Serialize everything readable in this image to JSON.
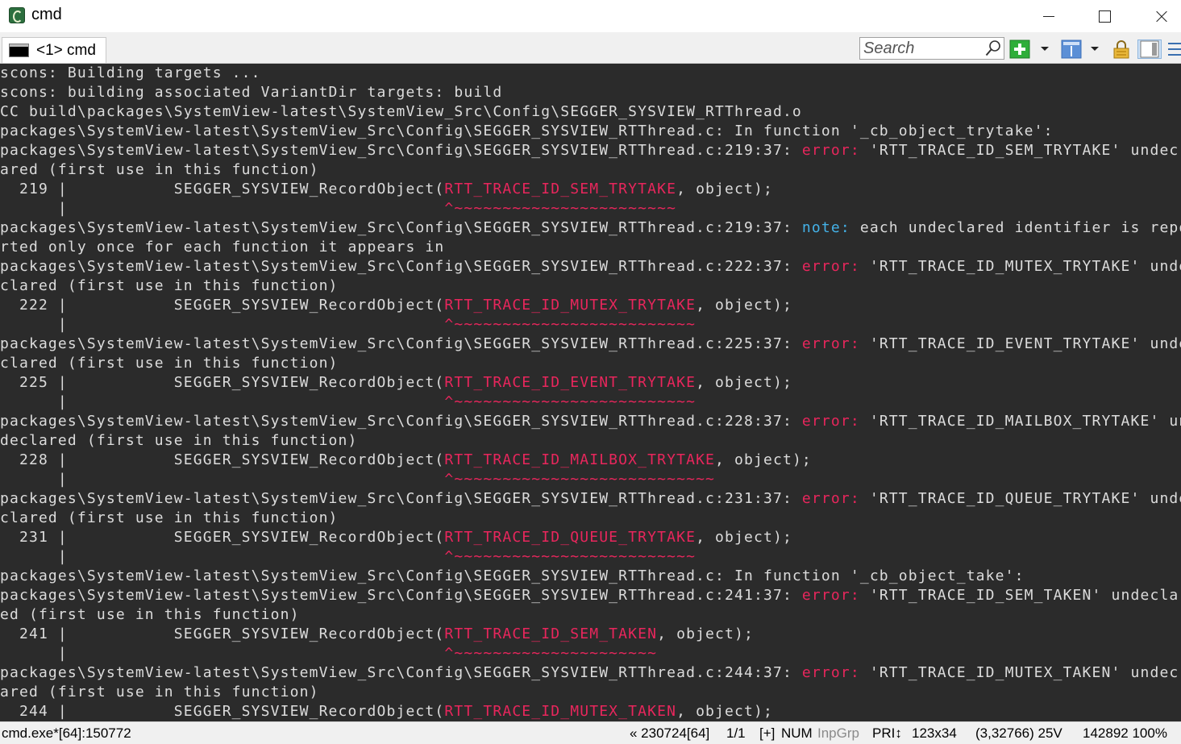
{
  "window": {
    "title": "cmd",
    "icon": "conemu-icon"
  },
  "tabs": [
    {
      "label": "<1> cmd",
      "icon": "console-icon",
      "active": true
    }
  ],
  "toolbar": {
    "search_placeholder": "Search"
  },
  "colors": {
    "console_bg": "#2b2b2b",
    "console_text": "#dcdcdc",
    "error": "#e8265c",
    "note": "#44b2e8"
  },
  "console": {
    "lines": [
      [
        {
          "t": "scons: Building targets ..."
        }
      ],
      [
        {
          "t": "scons: building associated VariantDir targets: build"
        }
      ],
      [
        {
          "t": "CC build\\packages\\SystemView-latest\\SystemView_Src\\Config\\SEGGER_SYSVIEW_RTThread.o"
        }
      ],
      [
        {
          "t": "packages\\SystemView-latest\\SystemView_Src\\Config\\SEGGER_SYSVIEW_RTThread.c: In function '_cb_object_trytake':"
        }
      ],
      [
        {
          "t": "packages\\SystemView-latest\\SystemView_Src\\Config\\SEGGER_SYSVIEW_RTThread.c:219:37: "
        },
        {
          "t": "error:",
          "c": "error"
        },
        {
          "t": " 'RTT_TRACE_ID_SEM_TRYTAKE' undec"
        }
      ],
      [
        {
          "t": "ared (first use in this function)"
        }
      ],
      [
        {
          "t": "  219 |           SEGGER_SYSVIEW_RecordObject("
        },
        {
          "t": "RTT_TRACE_ID_SEM_TRYTAKE",
          "c": "hl"
        },
        {
          "t": ", object);"
        }
      ],
      [
        {
          "t": "      |                                       "
        },
        {
          "t": "^~~~~~~~~~~~~~~~~~~~~~~~",
          "c": "caret"
        }
      ],
      [
        {
          "t": "packages\\SystemView-latest\\SystemView_Src\\Config\\SEGGER_SYSVIEW_RTThread.c:219:37: "
        },
        {
          "t": "note:",
          "c": "note"
        },
        {
          "t": " each undeclared identifier is repo"
        }
      ],
      [
        {
          "t": "rted only once for each function it appears in"
        }
      ],
      [
        {
          "t": "packages\\SystemView-latest\\SystemView_Src\\Config\\SEGGER_SYSVIEW_RTThread.c:222:37: "
        },
        {
          "t": "error:",
          "c": "error"
        },
        {
          "t": " 'RTT_TRACE_ID_MUTEX_TRYTAKE' unde"
        }
      ],
      [
        {
          "t": "clared (first use in this function)"
        }
      ],
      [
        {
          "t": "  222 |           SEGGER_SYSVIEW_RecordObject("
        },
        {
          "t": "RTT_TRACE_ID_MUTEX_TRYTAKE",
          "c": "hl"
        },
        {
          "t": ", object);"
        }
      ],
      [
        {
          "t": "      |                                       "
        },
        {
          "t": "^~~~~~~~~~~~~~~~~~~~~~~~~~",
          "c": "caret"
        }
      ],
      [
        {
          "t": "packages\\SystemView-latest\\SystemView_Src\\Config\\SEGGER_SYSVIEW_RTThread.c:225:37: "
        },
        {
          "t": "error:",
          "c": "error"
        },
        {
          "t": " 'RTT_TRACE_ID_EVENT_TRYTAKE' unde"
        }
      ],
      [
        {
          "t": "clared (first use in this function)"
        }
      ],
      [
        {
          "t": "  225 |           SEGGER_SYSVIEW_RecordObject("
        },
        {
          "t": "RTT_TRACE_ID_EVENT_TRYTAKE",
          "c": "hl"
        },
        {
          "t": ", object);"
        }
      ],
      [
        {
          "t": "      |                                       "
        },
        {
          "t": "^~~~~~~~~~~~~~~~~~~~~~~~~~",
          "c": "caret"
        }
      ],
      [
        {
          "t": "packages\\SystemView-latest\\SystemView_Src\\Config\\SEGGER_SYSVIEW_RTThread.c:228:37: "
        },
        {
          "t": "error:",
          "c": "error"
        },
        {
          "t": " 'RTT_TRACE_ID_MAILBOX_TRYTAKE' un"
        }
      ],
      [
        {
          "t": "declared (first use in this function)"
        }
      ],
      [
        {
          "t": "  228 |           SEGGER_SYSVIEW_RecordObject("
        },
        {
          "t": "RTT_TRACE_ID_MAILBOX_TRYTAKE",
          "c": "hl"
        },
        {
          "t": ", object);"
        }
      ],
      [
        {
          "t": "      |                                       "
        },
        {
          "t": "^~~~~~~~~~~~~~~~~~~~~~~~~~~~",
          "c": "caret"
        }
      ],
      [
        {
          "t": "packages\\SystemView-latest\\SystemView_Src\\Config\\SEGGER_SYSVIEW_RTThread.c:231:37: "
        },
        {
          "t": "error:",
          "c": "error"
        },
        {
          "t": " 'RTT_TRACE_ID_QUEUE_TRYTAKE' unde"
        }
      ],
      [
        {
          "t": "clared (first use in this function)"
        }
      ],
      [
        {
          "t": "  231 |           SEGGER_SYSVIEW_RecordObject("
        },
        {
          "t": "RTT_TRACE_ID_QUEUE_TRYTAKE",
          "c": "hl"
        },
        {
          "t": ", object);"
        }
      ],
      [
        {
          "t": "      |                                       "
        },
        {
          "t": "^~~~~~~~~~~~~~~~~~~~~~~~~~",
          "c": "caret"
        }
      ],
      [
        {
          "t": "packages\\SystemView-latest\\SystemView_Src\\Config\\SEGGER_SYSVIEW_RTThread.c: In function '_cb_object_take':"
        }
      ],
      [
        {
          "t": "packages\\SystemView-latest\\SystemView_Src\\Config\\SEGGER_SYSVIEW_RTThread.c:241:37: "
        },
        {
          "t": "error:",
          "c": "error"
        },
        {
          "t": " 'RTT_TRACE_ID_SEM_TAKEN' undecla"
        }
      ],
      [
        {
          "t": "ed (first use in this function)"
        }
      ],
      [
        {
          "t": "  241 |           SEGGER_SYSVIEW_RecordObject("
        },
        {
          "t": "RTT_TRACE_ID_SEM_TAKEN",
          "c": "hl"
        },
        {
          "t": ", object);"
        }
      ],
      [
        {
          "t": "      |                                       "
        },
        {
          "t": "^~~~~~~~~~~~~~~~~~~~~~",
          "c": "caret"
        }
      ],
      [
        {
          "t": "packages\\SystemView-latest\\SystemView_Src\\Config\\SEGGER_SYSVIEW_RTThread.c:244:37: "
        },
        {
          "t": "error:",
          "c": "error"
        },
        {
          "t": " 'RTT_TRACE_ID_MUTEX_TAKEN' undec"
        }
      ],
      [
        {
          "t": "ared (first use in this function)"
        }
      ],
      [
        {
          "t": "  244 |           SEGGER_SYSVIEW_RecordObject("
        },
        {
          "t": "RTT_TRACE_ID_MUTEX_TAKEN",
          "c": "hl"
        },
        {
          "t": ", object);"
        }
      ]
    ]
  },
  "status": {
    "process": "cmd.exe*[64]:150772",
    "console_info": "« 230724[64]",
    "page": "1/1",
    "insert": "[+]",
    "num": "NUM",
    "inpgrp": "InpGrp",
    "pri": "PRI↕",
    "size": "123x34",
    "cursor": "(3,32766) 25V",
    "buffer": "142892 100%"
  }
}
